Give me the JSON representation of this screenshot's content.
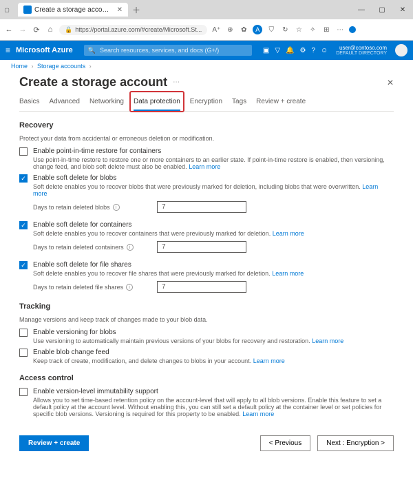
{
  "browser": {
    "tab_title": "Create a storage account - Micr...",
    "url": "https://portal.azure.com/#create/Microsoft.St..."
  },
  "azure_header": {
    "brand": "Microsoft Azure",
    "search_placeholder": "Search resources, services, and docs (G+/)",
    "user_email": "user@contoso.com",
    "directory": "DEFAULT DIRECTORY"
  },
  "breadcrumb": {
    "home": "Home",
    "storage_accounts": "Storage accounts"
  },
  "page_title": "Create a storage account",
  "tabs": [
    "Basics",
    "Advanced",
    "Networking",
    "Data protection",
    "Encryption",
    "Tags",
    "Review + create"
  ],
  "recovery": {
    "heading": "Recovery",
    "desc": "Protect your data from accidental or erroneous deletion or modification.",
    "pit_label": "Enable point-in-time restore for containers",
    "pit_help": "Use point-in-time restore to restore one or more containers to an earlier state. If point-in-time restore is enabled, then versioning, change feed, and blob soft delete must also be enabled.",
    "blob_sd_label": "Enable soft delete for blobs",
    "blob_sd_help": "Soft delete enables you to recover blobs that were previously marked for deletion, including blobs that were overwritten.",
    "blob_days_label": "Days to retain deleted blobs",
    "blob_days_value": "7",
    "cont_sd_label": "Enable soft delete for containers",
    "cont_sd_help": "Soft delete enables you to recover containers that were previously marked for deletion.",
    "cont_days_label": "Days to retain deleted containers",
    "cont_days_value": "7",
    "fs_sd_label": "Enable soft delete for file shares",
    "fs_sd_help": "Soft delete enables you to recover file shares that were previously marked for deletion.",
    "fs_days_label": "Days to retain deleted file shares",
    "fs_days_value": "7",
    "learn_more": "Learn more"
  },
  "tracking": {
    "heading": "Tracking",
    "desc": "Manage versions and keep track of changes made to your blob data.",
    "versioning_label": "Enable versioning for blobs",
    "versioning_help": "Use versioning to automatically maintain previous versions of your blobs for recovery and restoration.",
    "changefeed_label": "Enable blob change feed",
    "changefeed_help": "Keep track of create, modification, and delete changes to blobs in your account.",
    "learn_more": "Learn more"
  },
  "access": {
    "heading": "Access control",
    "immutability_label": "Enable version-level immutability support",
    "immutability_help": "Allows you to set time-based retention policy on the account-level that will apply to all blob versions. Enable this feature to set a default policy at the account level. Without enabling this, you can still set a default policy at the container level or set policies for specific blob versions. Versioning is required for this property to be enabled.",
    "learn_more": "Learn more"
  },
  "footer": {
    "review": "Review + create",
    "previous": "< Previous",
    "next": "Next : Encryption >"
  }
}
